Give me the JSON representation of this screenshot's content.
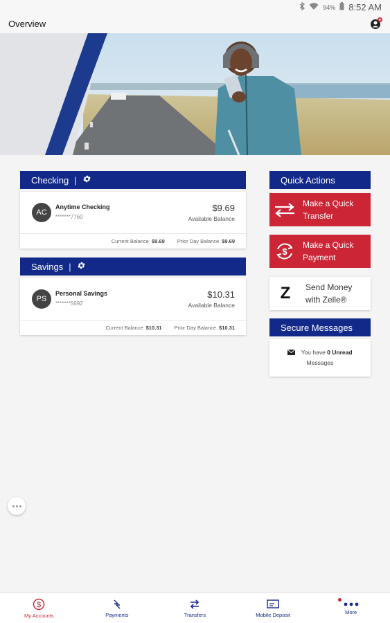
{
  "status_bar": {
    "battery": "94%",
    "time": "8:52 AM"
  },
  "header": {
    "title": "Overview"
  },
  "checking": {
    "title": "Checking",
    "separator": "|",
    "account": {
      "initials": "AC",
      "name": "Anytime Checking",
      "number": "*******7760",
      "balance": "$9.69",
      "balance_label": "Available Balance",
      "current_label": "Current Balance",
      "current_value": "$9.69",
      "prior_label": "Prior Day Balance",
      "prior_value": "$9.69"
    }
  },
  "savings": {
    "title": "Savings",
    "separator": "|",
    "account": {
      "initials": "PS",
      "name": "Personal Savings",
      "number": "*******5692",
      "balance": "$10.31",
      "balance_label": "Available Balance",
      "current_label": "Current Balance",
      "current_value": "$10.31",
      "prior_label": "Prior Day Balance",
      "prior_value": "$10.31"
    }
  },
  "quick_actions": {
    "title": "Quick Actions",
    "transfer_line1": "Make a Quick",
    "transfer_line2": "Transfer",
    "payment_line1": "Make a Quick",
    "payment_line2": "Payment",
    "zelle_line1": "Send Money",
    "zelle_line2": "with Zelle®",
    "zelle_icon": "Z"
  },
  "secure_messages": {
    "title": "Secure Messages",
    "prefix": "You have",
    "count": "0 Unread",
    "suffix": "Messages"
  },
  "bottom_nav": [
    {
      "label": "My Accounts",
      "icon": "dollar-circle-icon"
    },
    {
      "label": "Payments",
      "icon": "payments-icon"
    },
    {
      "label": "Transfers",
      "icon": "transfer-arrows-icon"
    },
    {
      "label": "Mobile Deposit",
      "icon": "check-deposit-icon"
    },
    {
      "label": "More",
      "icon": "more-dots-icon"
    }
  ],
  "colors": {
    "navy": "#13298a",
    "red": "#cc2536",
    "background": "#f4f4f4"
  }
}
